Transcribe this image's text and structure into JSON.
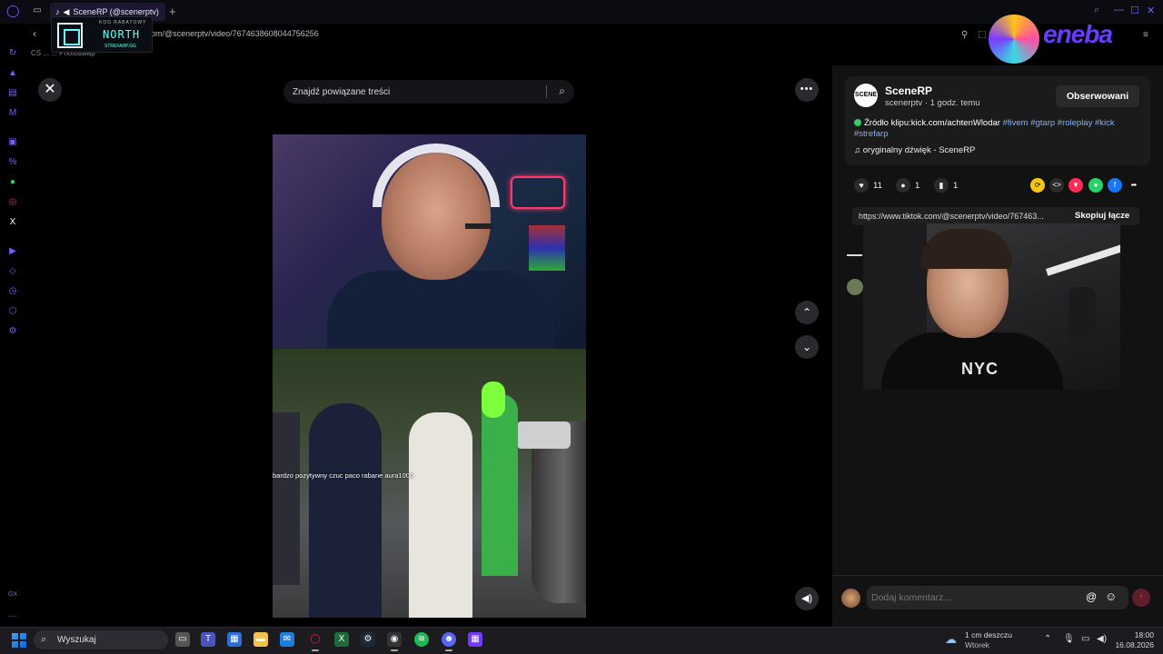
{
  "browser": {
    "tab_title": "SceneRP (@scenerptv)",
    "new_tab_icon": "plus",
    "url": "om/@scenerptv/video/7674638608044756256",
    "bookmarks": "CS  ...  ...  Photoswap"
  },
  "overlay_north": {
    "top_text": "KOD RABATOWY",
    "brand": "NORTH",
    "sub": "STREFARP.GG"
  },
  "overlay_eneba": {
    "word": "eneba"
  },
  "video": {
    "search_placeholder": "Znajdź powiązane treści",
    "caption": "bardzo pozytywny czuc paco rabane aura1000"
  },
  "post": {
    "account_name": "SceneRP",
    "account_sub": "scenerptv · 1 godz. temu",
    "avatar_text": "SCENE",
    "follow_label": "Obserwowani",
    "desc_prefix": "Źródło klipu:kick.com/achtenWlodar",
    "desc_tags": "#fivem #gtarp #roleplay #kick #strefarp",
    "sound": "oryginalny dźwięk - SceneRP",
    "likes": "11",
    "comments": "1",
    "saves": "1",
    "link": "https://www.tiktok.com/@scenerptv/video/767463...",
    "copy_link_label": "Skopiuj łącze",
    "comment_placeholder": "Dodaj komentarz..."
  },
  "webcam_overlay": {
    "shirt_text": "NYC"
  },
  "taskbar": {
    "search_label": "Wyszukaj",
    "weather_line1": "1 cm deszczu",
    "weather_line2": "Wtorek",
    "time": "18:00",
    "date": "16.08.2026"
  },
  "colors": {
    "accent": "#7b5cff",
    "tag_blue": "#7fb3ff",
    "panel": "#121212",
    "card": "#1b1b1b"
  }
}
